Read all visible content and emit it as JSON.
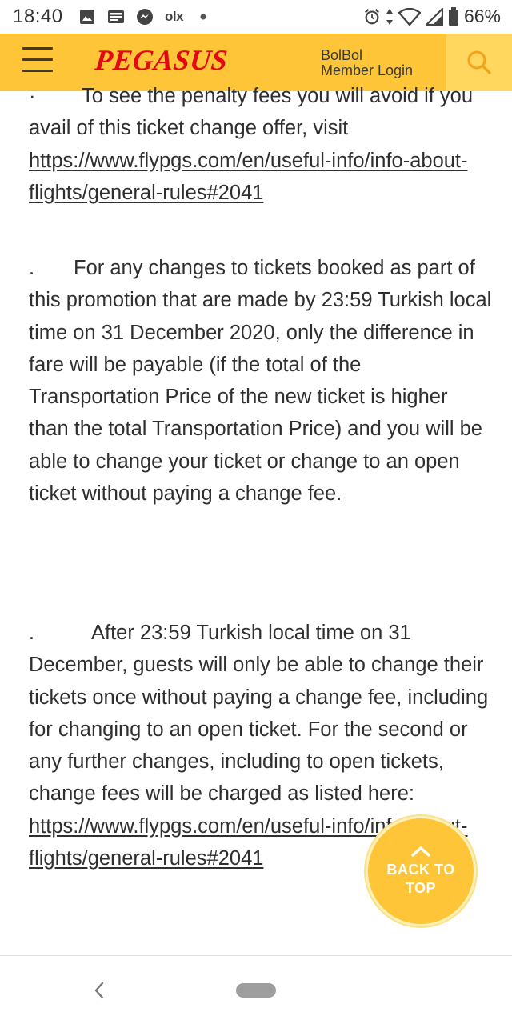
{
  "status_bar": {
    "time": "18:40",
    "left_icons": [
      "photo-icon",
      "news-icon",
      "messenger-icon",
      "olx-icon",
      "dot-icon"
    ],
    "olx_text": "olx",
    "right_icons": [
      "alarm-icon",
      "data-arrows-icon",
      "wifi-icon",
      "signal-icon",
      "battery-icon"
    ],
    "battery": "66%"
  },
  "header": {
    "logo": "PEGASUS",
    "member_line1": "BolBol",
    "member_line2": "Member Login",
    "colors": {
      "bar": "#fdc537",
      "logo": "#e10a14"
    }
  },
  "content": {
    "paragraph1": {
      "bullet": "·",
      "text": "To see the penalty fees you will avoid if you avail of this ticket change offer, visit ",
      "link": "https://www.flypgs.com/en/useful-info/info-about-flights/general-rules#2041"
    },
    "paragraph2": {
      "bullet": ".",
      "text": "For any changes to tickets booked as part of this promotion that are made by 23:59 Turkish local time on 31 December 2020, only the difference in fare will be payable (if the total of the Transportation Price of the new ticket is higher than the total Transportation Price) and you will be able to change your ticket or change to an open ticket without paying a change fee."
    },
    "paragraph3": {
      "bullet": ".",
      "text": "After 23:59 Turkish local time on 31 December, guests will only be able to change their tickets once without paying a change fee, including for changing to an open ticket. For the second or any further changes, including to open tickets, change fees will be charged as listed here: ",
      "link": "https://www.flypgs.com/en/useful-info/info-about-flights/general-rules#2041"
    }
  },
  "back_to_top": {
    "line1": "BACK TO",
    "line2": "TOP"
  },
  "nav_bar": {
    "icons": [
      "back-icon",
      "home-pill-icon"
    ]
  }
}
